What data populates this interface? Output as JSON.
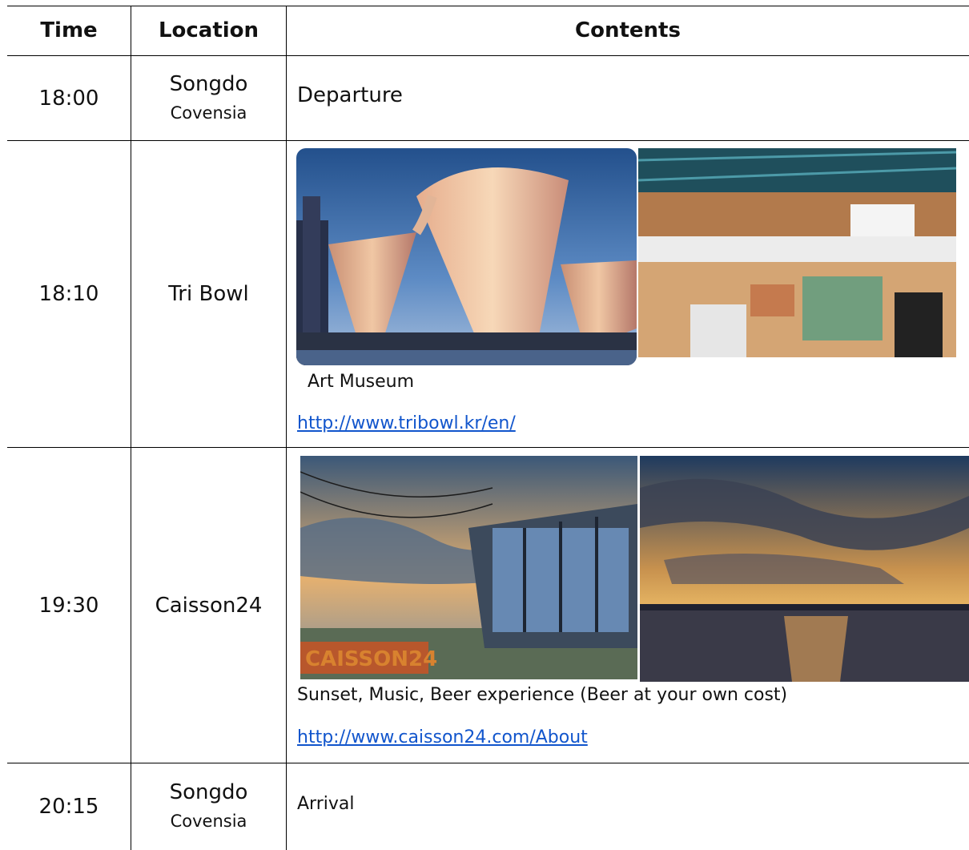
{
  "header": {
    "time": "Time",
    "location": "Location",
    "contents": "Contents"
  },
  "rows": [
    {
      "time": "18:00",
      "location_line1": "Songdo",
      "location_line2": "Covensia",
      "contents": "Departure"
    },
    {
      "time": "18:10",
      "location": "Tri Bowl",
      "caption": "Art Museum",
      "url": "http://www.tribowl.kr/en/",
      "photos": [
        {
          "name": "tribowl-exterior-photo"
        },
        {
          "name": "tribowl-interior-photo"
        }
      ]
    },
    {
      "time": "19:30",
      "location": "Caisson24",
      "caption": "Sunset, Music, Beer experience (Beer at your own cost)",
      "url": "http://www.caisson24.com/About",
      "photos": [
        {
          "name": "caisson24-building-photo",
          "sign": "CAISSON24"
        },
        {
          "name": "sunset-sea-photo"
        }
      ]
    },
    {
      "time": "20:15",
      "location_line1": "Songdo",
      "location_line2": "Covensia",
      "contents": "Arrival"
    }
  ]
}
